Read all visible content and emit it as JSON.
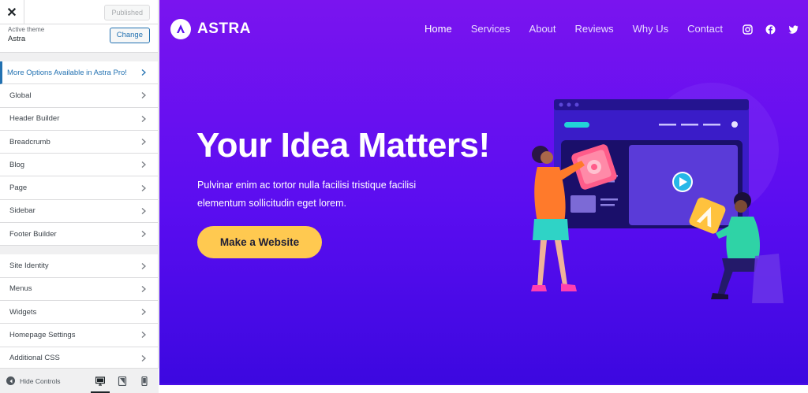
{
  "sidebar": {
    "close_label": "✕",
    "published_label": "Published",
    "active_theme_label": "Active theme",
    "active_theme_name": "Astra",
    "change_label": "Change",
    "pro_item": "More Options Available in Astra Pro!",
    "group1": [
      "Global",
      "Header Builder",
      "Breadcrumb",
      "Blog",
      "Page",
      "Sidebar",
      "Footer Builder"
    ],
    "group2": [
      "Site Identity",
      "Menus",
      "Widgets",
      "Homepage Settings",
      "Additional CSS"
    ],
    "hide_controls_label": "Hide Controls",
    "devices": [
      "desktop-icon",
      "tablet-icon",
      "mobile-icon"
    ]
  },
  "preview": {
    "logo_text": "ASTRA",
    "nav": [
      "Home",
      "Services",
      "About",
      "Reviews",
      "Why Us",
      "Contact"
    ],
    "social": [
      "instagram-icon",
      "facebook-icon",
      "twitter-icon"
    ],
    "hero_title": "Your Idea Matters!",
    "hero_text_line1": "Pulvinar enim ac tortor nulla facilisi tristique facilisi",
    "hero_text_line2": "elementum sollicitudin eget lorem.",
    "cta_label": "Make a Website"
  },
  "colors": {
    "accent": "#2271b1",
    "gradient_top": "#7a14ef",
    "gradient_bottom": "#3c08e0",
    "cta": "#ffc950"
  }
}
